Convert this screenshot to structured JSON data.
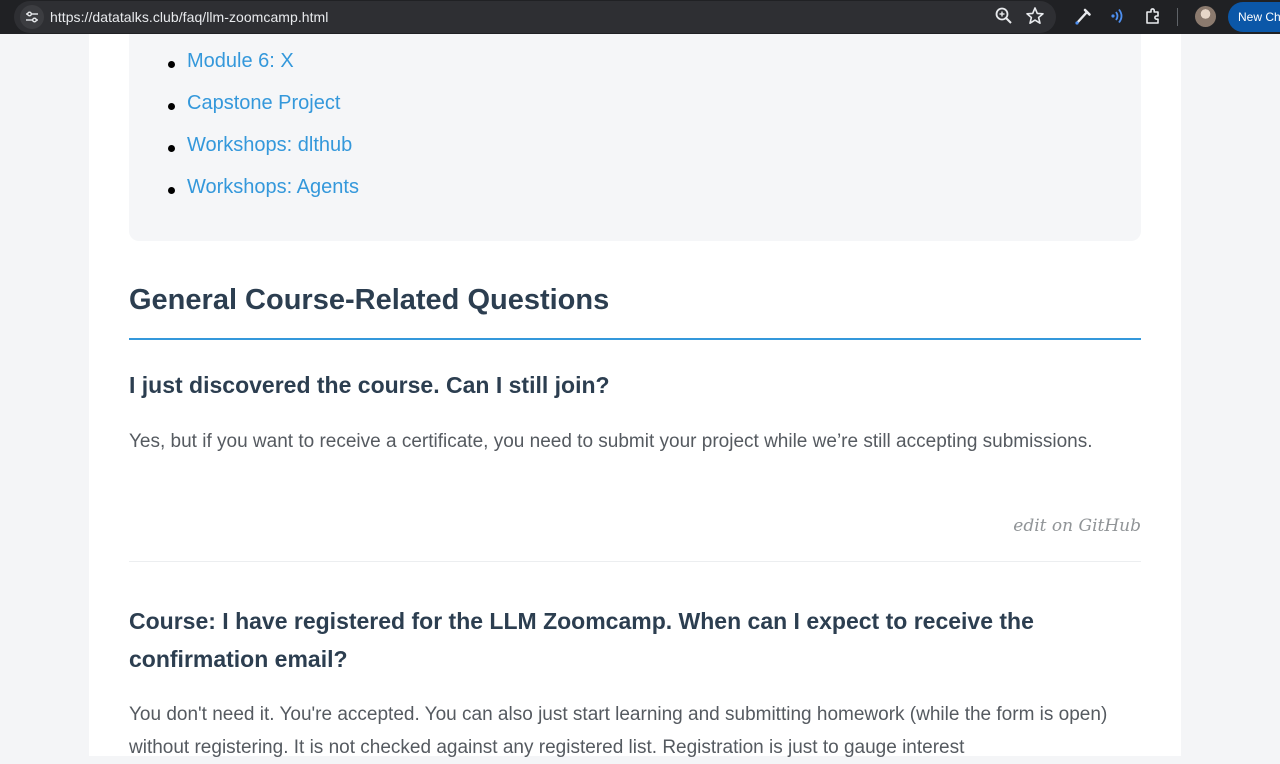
{
  "browser": {
    "url": "https://datatalks.club/faq/llm-zoomcamp.html",
    "new_tab_label": "New Chr"
  },
  "icons": {
    "site_info": "tune-icon",
    "zoom": "zoom-icon",
    "bookmark": "star-icon",
    "eyedropper": "eyedropper-icon",
    "read_aloud": "read-aloud-icon",
    "extensions": "puzzle-icon",
    "profile": "avatar"
  },
  "colors": {
    "link": "#3498db",
    "heading": "#2c3e50",
    "body_text": "#555a60",
    "muted": "#909497",
    "accent_rule": "#3498db"
  },
  "toc": {
    "items": [
      {
        "label": "Module 6: X"
      },
      {
        "label": "Capstone Project"
      },
      {
        "label": "Workshops: dlthub"
      },
      {
        "label": "Workshops: Agents"
      }
    ]
  },
  "section": {
    "title": "General Course-Related Questions"
  },
  "questions": [
    {
      "title": "I just discovered the course. Can I still join?",
      "answer": "Yes, but if you want to receive a certificate, you need to submit your project while we’re still accepting submissions.",
      "edit_label": "edit on GitHub"
    },
    {
      "title": "Course: I have registered for the LLM Zoomcamp. When can I expect to receive the confirmation email?",
      "answer": "You don't need it. You're accepted. You can also just start learning and submitting homework (while the form is open) without registering. It is not checked against any registered list. Registration is just to gauge interest"
    }
  ]
}
